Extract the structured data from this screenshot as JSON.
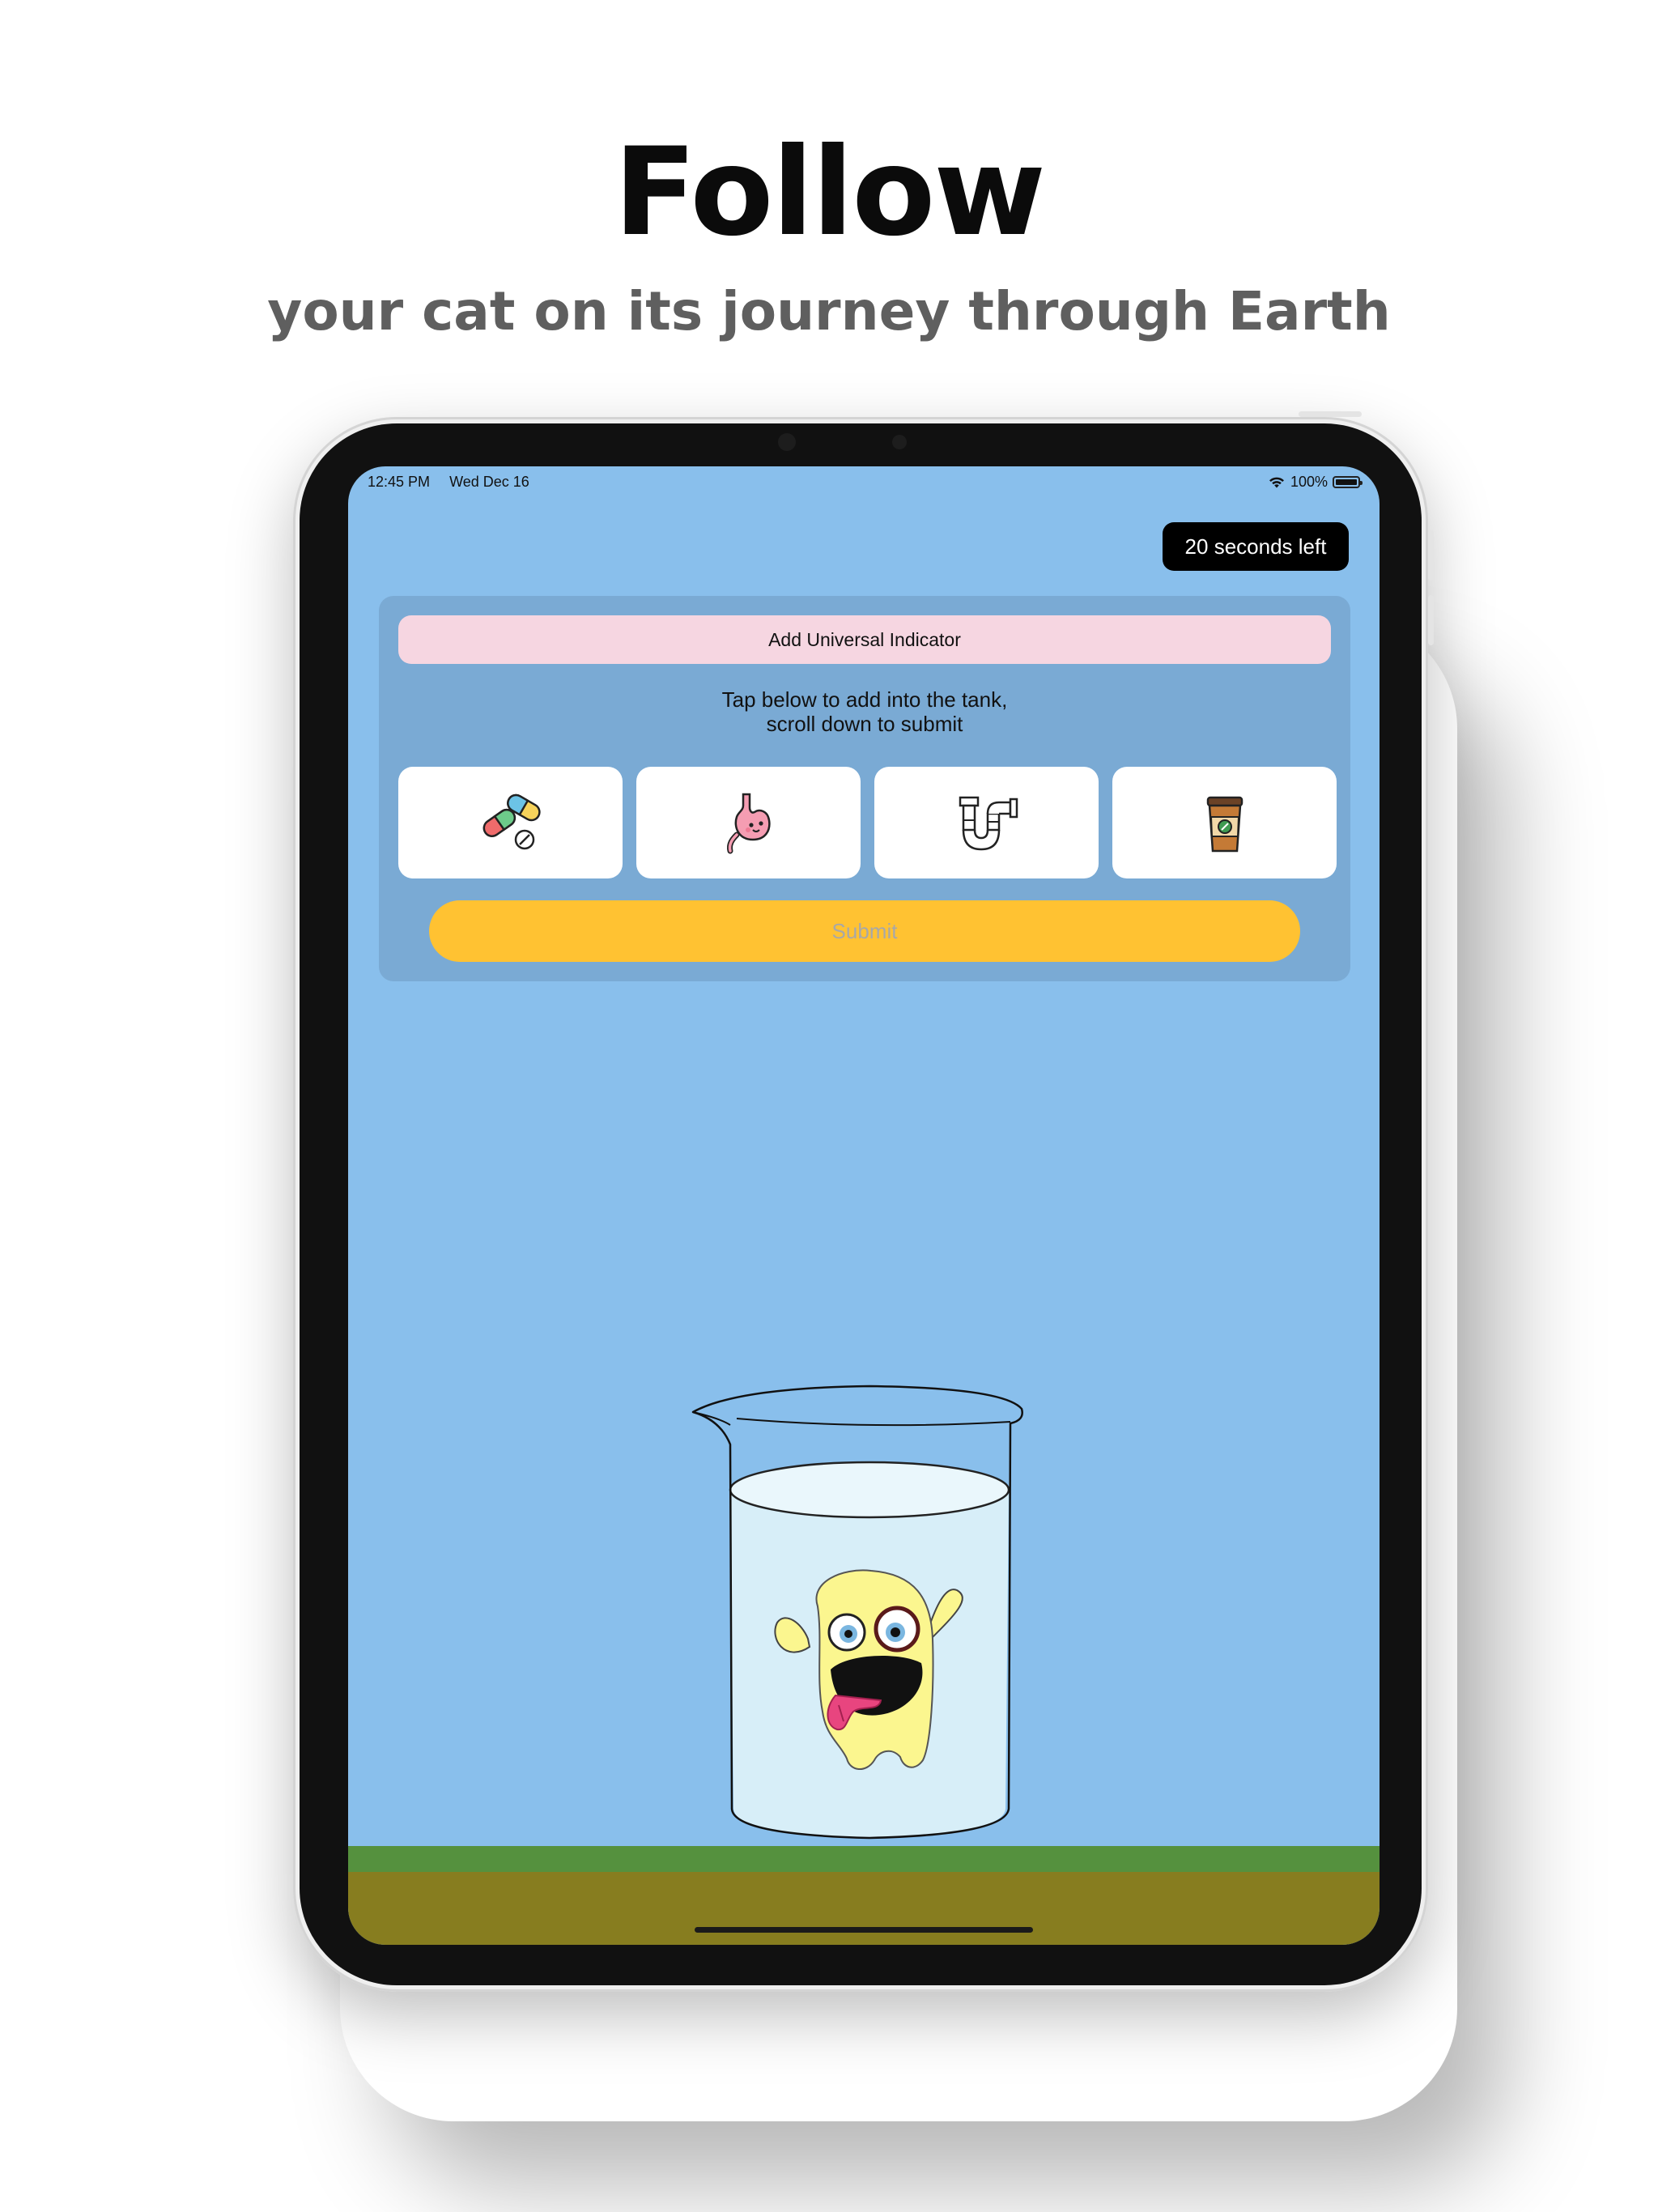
{
  "hero": {
    "title": "Follow",
    "subtitle": "your cat on its journey through Earth"
  },
  "status_bar": {
    "time": "12:45 PM",
    "date": "Wed Dec 16",
    "battery": "100%"
  },
  "timer": {
    "label": "20 seconds left"
  },
  "panel": {
    "indicator_label": "Add Universal Indicator",
    "instructions_line1": "Tap below to add into the tank,",
    "instructions_line2": "scroll down to submit",
    "items": [
      {
        "icon": "pills-icon"
      },
      {
        "icon": "stomach-icon"
      },
      {
        "icon": "pipe-icon"
      },
      {
        "icon": "coffee-cup-icon"
      }
    ],
    "submit_label": "Submit"
  },
  "colors": {
    "screen_background": "#89bfec",
    "panel_background": "#7aaad4",
    "indicator_background": "#f6d6e1",
    "submit_background": "#ffc232",
    "grass": "#55913e",
    "dirt": "#877d1f",
    "monster": "#fbf68f"
  }
}
